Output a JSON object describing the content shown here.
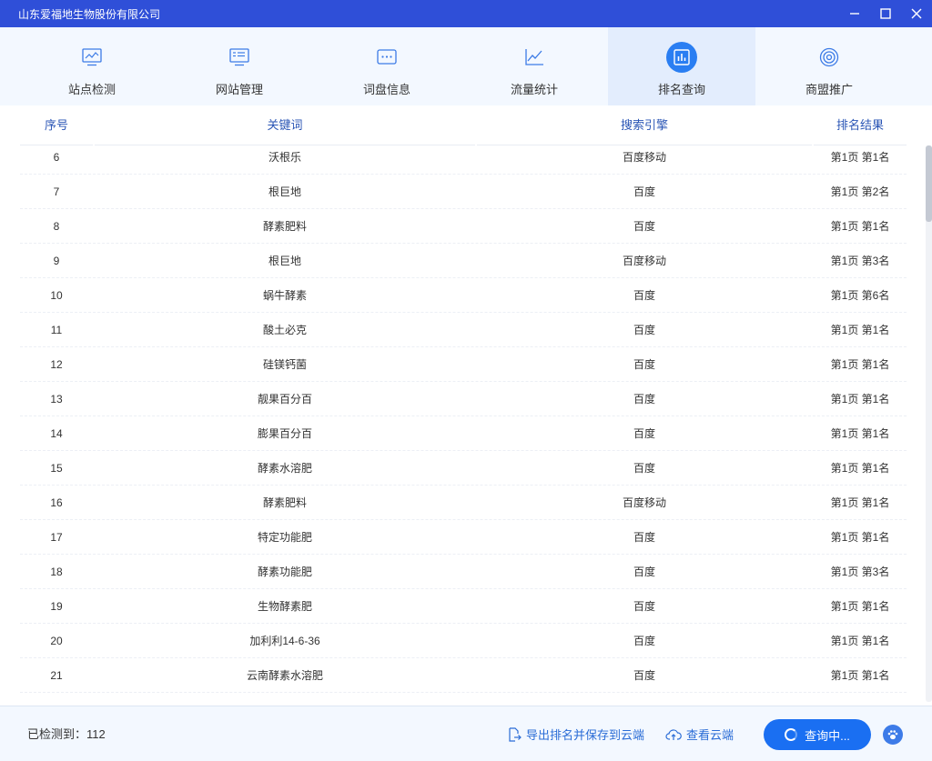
{
  "window": {
    "title": "山东爱福地生物股份有限公司"
  },
  "nav": {
    "tabs": [
      {
        "label": "站点检测",
        "icon": "monitor-chart-icon"
      },
      {
        "label": "网站管理",
        "icon": "website-panel-icon"
      },
      {
        "label": "词盘信息",
        "icon": "chat-dots-icon"
      },
      {
        "label": "流量统计",
        "icon": "line-chart-icon"
      },
      {
        "label": "排名查询",
        "icon": "bar-chart-icon",
        "active": true
      },
      {
        "label": "商盟推广",
        "icon": "target-icon"
      }
    ]
  },
  "table": {
    "headers": {
      "index": "序号",
      "keyword": "关键词",
      "engine": "搜索引擎",
      "result": "排名结果"
    },
    "rows": [
      {
        "index": "6",
        "keyword": "沃根乐",
        "engine": "百度移动",
        "result": "第1页 第1名"
      },
      {
        "index": "7",
        "keyword": "根巨地",
        "engine": "百度",
        "result": "第1页 第2名"
      },
      {
        "index": "8",
        "keyword": "酵素肥料",
        "engine": "百度",
        "result": "第1页 第1名"
      },
      {
        "index": "9",
        "keyword": "根巨地",
        "engine": "百度移动",
        "result": "第1页 第3名"
      },
      {
        "index": "10",
        "keyword": "蜗牛酵素",
        "engine": "百度",
        "result": "第1页 第6名"
      },
      {
        "index": "11",
        "keyword": "酸土必克",
        "engine": "百度",
        "result": "第1页 第1名"
      },
      {
        "index": "12",
        "keyword": "硅镁钙菌",
        "engine": "百度",
        "result": "第1页 第1名"
      },
      {
        "index": "13",
        "keyword": "靓果百分百",
        "engine": "百度",
        "result": "第1页 第1名"
      },
      {
        "index": "14",
        "keyword": "膨果百分百",
        "engine": "百度",
        "result": "第1页 第1名"
      },
      {
        "index": "15",
        "keyword": "酵素水溶肥",
        "engine": "百度",
        "result": "第1页 第1名"
      },
      {
        "index": "16",
        "keyword": "酵素肥料",
        "engine": "百度移动",
        "result": "第1页 第1名"
      },
      {
        "index": "17",
        "keyword": "特定功能肥",
        "engine": "百度",
        "result": "第1页 第1名"
      },
      {
        "index": "18",
        "keyword": "酵素功能肥",
        "engine": "百度",
        "result": "第1页 第3名"
      },
      {
        "index": "19",
        "keyword": "生物酵素肥",
        "engine": "百度",
        "result": "第1页 第1名"
      },
      {
        "index": "20",
        "keyword": "加利利14-6-36",
        "engine": "百度",
        "result": "第1页 第1名"
      },
      {
        "index": "21",
        "keyword": "云南酵素水溶肥",
        "engine": "百度",
        "result": "第1页 第1名"
      }
    ]
  },
  "footer": {
    "detected_label": "已检测到：112",
    "export_label": "导出排名并保存到云端",
    "cloud_label": "查看云端",
    "query_label": "查询中..."
  },
  "colors": {
    "titlebar": "#2f4fd8",
    "accent": "#1a6ff2",
    "header_text": "#2a55b5",
    "link": "#2a6cd6"
  }
}
